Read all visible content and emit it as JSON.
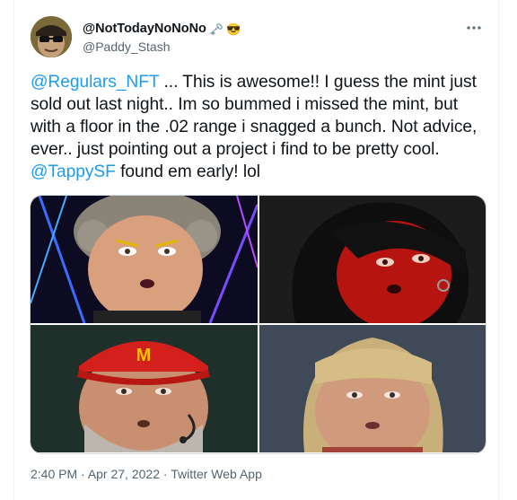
{
  "author": {
    "display_name": "@NotTodayNoNoNo",
    "handle": "@Paddy_Stash",
    "emoji": [
      "🗝️",
      "😎"
    ],
    "avatar_icon": "glasses-avatar"
  },
  "more_icon": "more-options-icon",
  "tweet": {
    "mention_1": "@Regulars_NFT",
    "text_1": " ... This is awesome!!  I guess the mint just sold out last night.. Im so bummed i missed the mint, but with a floor in the .02 range i snagged a bunch.  Not advice, ever.. just pointing out a project i find to be pretty cool. ",
    "mention_2": "@TappySF",
    "text_2": " found em early! lol"
  },
  "media": {
    "images": [
      {
        "name": "grey-curly-hair-character",
        "logo": ""
      },
      {
        "name": "red-skin-black-hair-character",
        "logo": ""
      },
      {
        "name": "red-cap-bearded-character",
        "logo": "M"
      },
      {
        "name": "blonde-bangs-character",
        "logo": ""
      }
    ]
  },
  "meta": {
    "time": "2:40 PM",
    "date": "Apr 27, 2022",
    "source": "Twitter Web App",
    "separator": " · "
  },
  "colors": {
    "link": "#1d9bf0",
    "secondary_text": "#536471",
    "border": "#cfd9de"
  }
}
